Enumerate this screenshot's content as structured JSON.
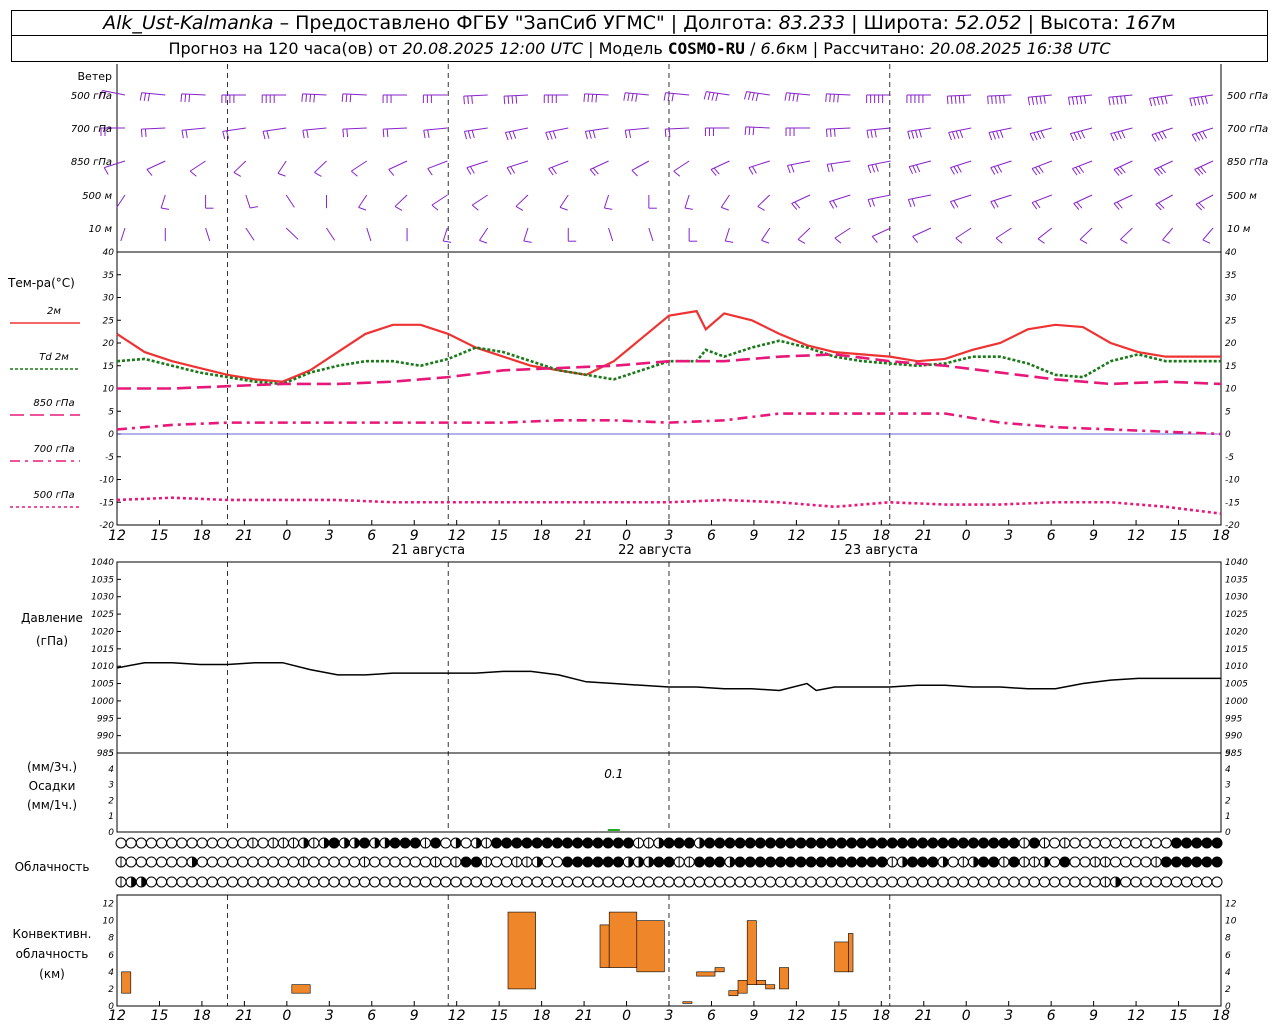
{
  "header": {
    "station": "Alk_Ust-Kalmanka",
    "sep1": " – ",
    "provider": "Предоставлено ФГБУ \"ЗапСиб УГМС\"",
    "lon_label": " | Долгота: ",
    "lon": "83.233",
    "lat_label": " | Широта: ",
    "lat": "52.052",
    "alt_label": " | Высота: ",
    "alt": "167",
    "alt_unit": "м",
    "fc_label": "Прогноз на 120 часа(ов) от ",
    "fc_time": "20.08.2025 12:00 UTC",
    "model_label": "  | Модель ",
    "model": "COSMO-RU",
    "res_sep": " / ",
    "res": "6.6",
    "res_unit": "км",
    "calc_label": " | Рассчитано: ",
    "calc_time": "20.08.2025 16:38 UTC"
  },
  "time_axis": {
    "tick_labels": [
      "12",
      "15",
      "18",
      "21",
      "0",
      "3",
      "6",
      "9",
      "12",
      "15",
      "18",
      "21",
      "0",
      "3",
      "6",
      "9",
      "12",
      "15",
      "18",
      "21",
      "0",
      "3",
      "6",
      "9",
      "12",
      "15",
      "18"
    ],
    "day_labels": [
      {
        "hour": 33,
        "text": "21 августа"
      },
      {
        "hour": 57,
        "text": "22 августа"
      },
      {
        "hour": 81,
        "text": "23 августа"
      }
    ]
  },
  "wind_panel": {
    "title": "Ветер",
    "levels": [
      "500 гПа",
      "700 гПа",
      "850 гПа",
      "500 м",
      "10  м"
    ],
    "color": "#8822cc"
  },
  "temp_panel": {
    "title": "Тем-ра(°C)",
    "legend": [
      {
        "label": "2м",
        "color": "#ee3333",
        "dash": ""
      },
      {
        "label": "Td  2м",
        "color": "#1a7a1a",
        "dash": "3,2"
      },
      {
        "label": "850 гПа",
        "color": "#e8187a",
        "dash": "14,6"
      },
      {
        "label": "700 гПа",
        "color": "#e8187a",
        "dash": "10,5,3,5"
      },
      {
        "label": "500 гПа",
        "color": "#e8187a",
        "dash": "3,3"
      }
    ]
  },
  "pressure_panel": {
    "title_line1": "Давление",
    "title_line2": "(гПа)"
  },
  "precip_panel": {
    "title_line1": "(мм/3ч.)",
    "title_line2": "Осадки",
    "title_line3": "(мм/1ч.)",
    "annotation": "0.1"
  },
  "cloud_panel": {
    "title": "Облачность"
  },
  "conv_panel": {
    "title_line1": "Конвективн.",
    "title_line2": "облачность",
    "title_line3": "(км)",
    "color": "#f0862a"
  },
  "chart_data": {
    "type": "line",
    "x_unit": "hours since 20.08.2025 12:00 UTC",
    "temperature": {
      "ylim": [
        -20,
        40
      ],
      "yticks": [
        -20,
        -15,
        -10,
        -5,
        0,
        5,
        10,
        15,
        20,
        25,
        30,
        35,
        40
      ],
      "series": [
        {
          "name": "2м",
          "x": [
            0,
            3,
            6,
            9,
            12,
            15,
            18,
            21,
            24,
            27,
            30,
            33,
            36,
            39,
            42,
            45,
            48,
            51,
            54,
            57,
            60,
            63,
            64,
            66,
            69,
            72,
            75,
            78,
            81,
            84,
            87,
            90,
            93,
            96,
            99,
            102,
            105,
            108,
            111,
            114,
            117,
            120
          ],
          "values": [
            22,
            18,
            16,
            14.5,
            13,
            12,
            11.5,
            14,
            18,
            22,
            24,
            24,
            22,
            19,
            17,
            15,
            14,
            13,
            16,
            21,
            26,
            27,
            23,
            26.5,
            25,
            22,
            19.5,
            18,
            17.5,
            17,
            16,
            16.5,
            18.5,
            20,
            23,
            24,
            23.5,
            20,
            18,
            17,
            17,
            17
          ]
        },
        {
          "name": "Td 2м",
          "x": [
            0,
            3,
            6,
            9,
            12,
            15,
            18,
            21,
            24,
            27,
            30,
            33,
            36,
            39,
            42,
            45,
            48,
            51,
            54,
            57,
            60,
            63,
            64,
            66,
            69,
            72,
            75,
            78,
            81,
            84,
            87,
            90,
            93,
            96,
            99,
            102,
            105,
            108,
            111,
            114,
            117,
            120
          ],
          "values": [
            16,
            16.5,
            15,
            13.5,
            12.5,
            11.5,
            11,
            13.5,
            15,
            16,
            16,
            15,
            16.5,
            19,
            18,
            16,
            14,
            13,
            12,
            14,
            16,
            16,
            18.5,
            17,
            19,
            20.5,
            19,
            17,
            16,
            15.5,
            15,
            15.5,
            17,
            17,
            15.5,
            13,
            12.5,
            16,
            17.5,
            16,
            16,
            16
          ]
        },
        {
          "name": "850 гПа",
          "x": [
            0,
            6,
            12,
            18,
            24,
            30,
            36,
            42,
            48,
            54,
            60,
            66,
            72,
            78,
            84,
            90,
            96,
            102,
            108,
            114,
            120
          ],
          "values": [
            10,
            10,
            10.5,
            11,
            11,
            11.5,
            12.5,
            14,
            14.5,
            15,
            16,
            16,
            17,
            17.5,
            16,
            15,
            13.5,
            12,
            11,
            11.5,
            11
          ]
        },
        {
          "name": "700 гПа",
          "x": [
            0,
            6,
            12,
            18,
            24,
            30,
            36,
            42,
            48,
            54,
            60,
            66,
            72,
            78,
            84,
            90,
            96,
            102,
            108,
            114,
            120
          ],
          "values": [
            1,
            2,
            2.5,
            2.5,
            2.5,
            2.5,
            2.5,
            2.5,
            3,
            3,
            2.5,
            3,
            4.5,
            4.5,
            4.5,
            4.5,
            2.5,
            1.5,
            1,
            0.5,
            0
          ]
        },
        {
          "name": "500 гПа",
          "x": [
            0,
            6,
            12,
            18,
            24,
            30,
            36,
            42,
            48,
            54,
            60,
            66,
            72,
            78,
            84,
            90,
            96,
            102,
            108,
            114,
            120
          ],
          "values": [
            -14.5,
            -14,
            -14.5,
            -14.5,
            -14.5,
            -15,
            -15,
            -15,
            -15,
            -15,
            -15,
            -14.5,
            -15,
            -16,
            -15,
            -15.5,
            -15.5,
            -15,
            -15,
            -16,
            -17.5
          ]
        }
      ]
    },
    "pressure": {
      "ylim": [
        985,
        1040
      ],
      "yticks": [
        985,
        990,
        995,
        1000,
        1005,
        1010,
        1015,
        1020,
        1025,
        1030,
        1035,
        1040
      ],
      "x": [
        0,
        3,
        6,
        9,
        12,
        15,
        18,
        21,
        24,
        27,
        30,
        33,
        36,
        39,
        42,
        45,
        48,
        51,
        54,
        57,
        60,
        63,
        66,
        69,
        72,
        75,
        76,
        77,
        78,
        81,
        84,
        87,
        90,
        93,
        96,
        99,
        102,
        105,
        108,
        111,
        114,
        117,
        120
      ],
      "values": [
        1009.5,
        1011,
        1011,
        1010.5,
        1010.5,
        1011,
        1011,
        1009,
        1007.5,
        1007.5,
        1008,
        1008,
        1008,
        1008,
        1008.5,
        1008.5,
        1007.5,
        1005.5,
        1005,
        1004.5,
        1004,
        1004,
        1003.5,
        1003.5,
        1003,
        1005,
        1003,
        1003.5,
        1004,
        1004,
        1004,
        1004.5,
        1004.5,
        1004,
        1004,
        1003.5,
        1003.5,
        1005,
        1006,
        1006.5,
        1006.5,
        1006.5,
        1006.5
      ]
    },
    "precipitation": {
      "ylim": [
        0,
        5
      ],
      "yticks": [
        0,
        1,
        2,
        3,
        4,
        5
      ],
      "bars": [
        {
          "x": 54,
          "value": 0.1
        }
      ]
    },
    "convective_cloud": {
      "ylim": [
        0,
        13
      ],
      "yticks": [
        0,
        2,
        4,
        6,
        8,
        10,
        12
      ],
      "bars": [
        {
          "x0": 0.5,
          "x1": 1.5,
          "base": 1.5,
          "top": 4
        },
        {
          "x0": 19,
          "x1": 21,
          "base": 1.5,
          "top": 2.5
        },
        {
          "x0": 42.5,
          "x1": 45.5,
          "base": 2,
          "top": 11
        },
        {
          "x0": 52.5,
          "x1": 53.5,
          "base": 4.5,
          "top": 9.5
        },
        {
          "x0": 53.5,
          "x1": 56.5,
          "base": 4.5,
          "top": 11
        },
        {
          "x0": 56.5,
          "x1": 59.5,
          "base": 4,
          "top": 10
        },
        {
          "x0": 61.5,
          "x1": 62.5,
          "base": 0.3,
          "top": 0.5
        },
        {
          "x0": 63,
          "x1": 65,
          "base": 3.5,
          "top": 4
        },
        {
          "x0": 65,
          "x1": 66,
          "base": 4,
          "top": 4.5
        },
        {
          "x0": 66.5,
          "x1": 67.5,
          "base": 1.2,
          "top": 1.8
        },
        {
          "x0": 67.5,
          "x1": 68.5,
          "base": 1.5,
          "top": 3
        },
        {
          "x0": 68.5,
          "x1": 69.5,
          "base": 2.5,
          "top": 10
        },
        {
          "x0": 69.5,
          "x1": 70.5,
          "base": 2.5,
          "top": 3
        },
        {
          "x0": 70.5,
          "x1": 71.5,
          "base": 2,
          "top": 2.5
        },
        {
          "x0": 72,
          "x1": 73,
          "base": 2,
          "top": 4.5
        },
        {
          "x0": 78,
          "x1": 79.5,
          "base": 4,
          "top": 7.5
        },
        {
          "x0": 79.5,
          "x1": 80,
          "base": 4,
          "top": 8.5
        }
      ]
    },
    "cloud_cover": {
      "rows": [
        "0000000000000101112123223223331302021333333333333331123332333333333333333333333333333333313101000000000033333",
        "1000000200000000001000001000000101331001120033333322233113332333333333333333123332012331311203001100001333333",
        "1220000000000000000000000000000000000000000000000000000000000000000000000000000000000000000000000120000000000"
      ]
    },
    "wind_barbs": {
      "note": "speed in knots, direction in degrees (from)",
      "levels": [
        {
          "name": "500 гПа",
          "dir": [
            290,
            280,
            275,
            270,
            270,
            275,
            275,
            270,
            270,
            265,
            265,
            270,
            275,
            280,
            280,
            285,
            285,
            280,
            275,
            270,
            270,
            265,
            265,
            260,
            260,
            260,
            255,
            255
          ],
          "spd": [
            25,
            30,
            35,
            40,
            40,
            40,
            35,
            35,
            35,
            35,
            40,
            40,
            40,
            40,
            35,
            40,
            45,
            45,
            45,
            50,
            50,
            50,
            55,
            55,
            55,
            55,
            55,
            60
          ]
        },
        {
          "name": "700 гПа",
          "dir": [
            270,
            265,
            260,
            255,
            255,
            260,
            265,
            265,
            260,
            255,
            250,
            250,
            255,
            260,
            265,
            270,
            275,
            270,
            265,
            260,
            255,
            250,
            250,
            245,
            245,
            245,
            240,
            240
          ],
          "spd": [
            20,
            20,
            25,
            25,
            25,
            25,
            20,
            25,
            25,
            30,
            30,
            30,
            30,
            25,
            25,
            30,
            30,
            35,
            35,
            35,
            40,
            40,
            40,
            40,
            40,
            40,
            45,
            45
          ]
        },
        {
          "name": "850 гПа",
          "dir": [
            240,
            230,
            220,
            210,
            200,
            210,
            220,
            230,
            235,
            240,
            240,
            235,
            230,
            225,
            220,
            230,
            240,
            250,
            255,
            250,
            245,
            240,
            240,
            235,
            235,
            230,
            230,
            230
          ],
          "spd": [
            10,
            10,
            15,
            15,
            15,
            15,
            15,
            15,
            15,
            20,
            20,
            20,
            20,
            15,
            15,
            20,
            20,
            25,
            25,
            30,
            30,
            30,
            30,
            30,
            30,
            35,
            35,
            35
          ]
        },
        {
          "name": "500 м",
          "dir": [
            200,
            190,
            180,
            170,
            160,
            180,
            200,
            210,
            220,
            220,
            210,
            200,
            190,
            180,
            190,
            200,
            210,
            230,
            240,
            250,
            250,
            240,
            240,
            235,
            230,
            230,
            225,
            225
          ],
          "spd": [
            5,
            10,
            10,
            10,
            5,
            5,
            10,
            10,
            10,
            15,
            15,
            15,
            10,
            10,
            15,
            15,
            15,
            20,
            20,
            25,
            25,
            25,
            25,
            25,
            25,
            25,
            25,
            25
          ]
        },
        {
          "name": "10  м",
          "dir": [
            190,
            180,
            170,
            160,
            150,
            160,
            170,
            180,
            190,
            200,
            190,
            180,
            170,
            170,
            180,
            190,
            200,
            210,
            220,
            230,
            230,
            220,
            220,
            215,
            210,
            210,
            205,
            205
          ],
          "spd": [
            5,
            5,
            5,
            5,
            5,
            5,
            5,
            5,
            10,
            10,
            10,
            10,
            5,
            5,
            10,
            10,
            10,
            10,
            10,
            15,
            15,
            15,
            15,
            15,
            10,
            10,
            10,
            10
          ]
        }
      ]
    }
  }
}
